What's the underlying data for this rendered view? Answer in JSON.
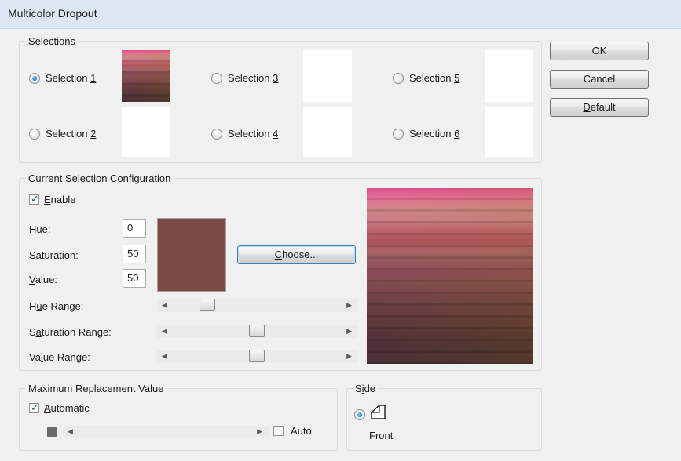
{
  "window": {
    "title": "Multicolor Dropout"
  },
  "buttons": {
    "ok": "OK",
    "cancel": "Cancel",
    "default": "Default"
  },
  "selections": {
    "group_label": "Selections",
    "items": [
      {
        "label": "Selection 1",
        "checked": true
      },
      {
        "label": "Selection 2",
        "checked": false
      },
      {
        "label": "Selection 3",
        "checked": false
      },
      {
        "label": "Selection 4",
        "checked": false
      },
      {
        "label": "Selection 5",
        "checked": false
      },
      {
        "label": "Selection 6",
        "checked": false
      }
    ]
  },
  "config": {
    "group_label": "Current Selection Configuration",
    "enable_label": "Enable",
    "enable_checked": true,
    "hue_label": "Hue:",
    "hue_value": "0",
    "saturation_label": "Saturation:",
    "saturation_value": "50",
    "value_label": "Value:",
    "value_value": "50",
    "choose_label": "Choose...",
    "hue_range_label": "Hue Range:",
    "saturation_range_label": "Saturation Range:",
    "value_range_label": "Value Range:",
    "hue_range_level": 0.2,
    "saturation_range_level": 0.5,
    "value_range_level": 0.5,
    "color": "#7c4a46"
  },
  "max_replacement": {
    "group_label": "Maximum Replacement Value",
    "automatic_label": "Automatic",
    "automatic_checked": true,
    "auto_label": "Auto",
    "auto_checked": false
  },
  "side": {
    "group_label": "Side",
    "front_label": "Front",
    "front_checked": true
  }
}
